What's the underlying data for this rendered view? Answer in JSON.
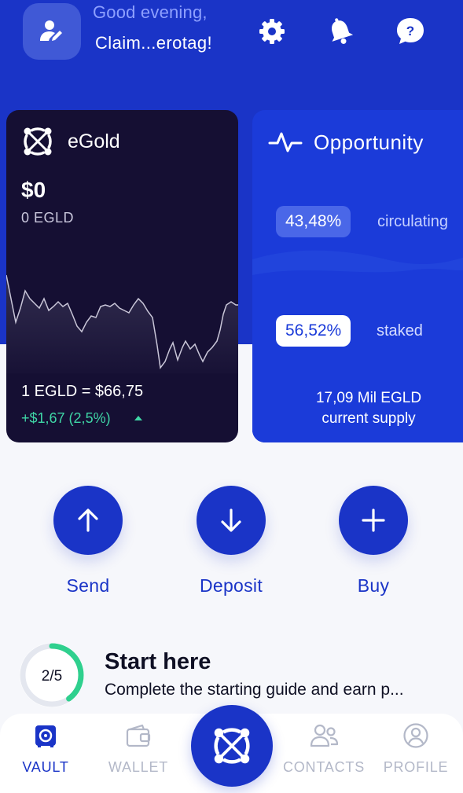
{
  "header": {
    "greeting": "Good evening,",
    "username": "Claim...erotag!",
    "icons": [
      "settings-icon",
      "bell-icon",
      "help-icon"
    ]
  },
  "egold_card": {
    "name": "eGold",
    "usd_balance": "$0",
    "egld_balance": "0 EGLD",
    "price": "1 EGLD = $66,75",
    "change": "+$1,67 (2,5%)",
    "trend": "up"
  },
  "opportunity_card": {
    "title": "Opportunity",
    "circulating_pct": "43,48%",
    "circulating_label": "circulating",
    "staked_pct": "56,52%",
    "staked_label": "staked",
    "supply_value": "17,09 Mil EGLD",
    "supply_label": "current supply"
  },
  "actions": [
    {
      "label": "Send",
      "icon": "arrow-up-icon"
    },
    {
      "label": "Deposit",
      "icon": "arrow-down-icon"
    },
    {
      "label": "Buy",
      "icon": "plus-icon"
    }
  ],
  "start_here": {
    "progress_text": "2/5",
    "progress_fraction": 0.4,
    "title": "Start here",
    "subtitle": "Complete the starting guide and earn p..."
  },
  "nav": {
    "items": [
      {
        "label": "VAULT",
        "icon": "vault-icon",
        "active": true
      },
      {
        "label": "WALLET",
        "icon": "wallet-icon",
        "active": false
      },
      {
        "label": "CONTACTS",
        "icon": "contacts-icon",
        "active": false
      },
      {
        "label": "PROFILE",
        "icon": "profile-icon",
        "active": false
      }
    ],
    "center_icon": "egld-logo-icon"
  },
  "colors": {
    "brand_blue": "#1a34c7",
    "card_dark": "#150f33",
    "positive_green": "#3fd6a6"
  }
}
